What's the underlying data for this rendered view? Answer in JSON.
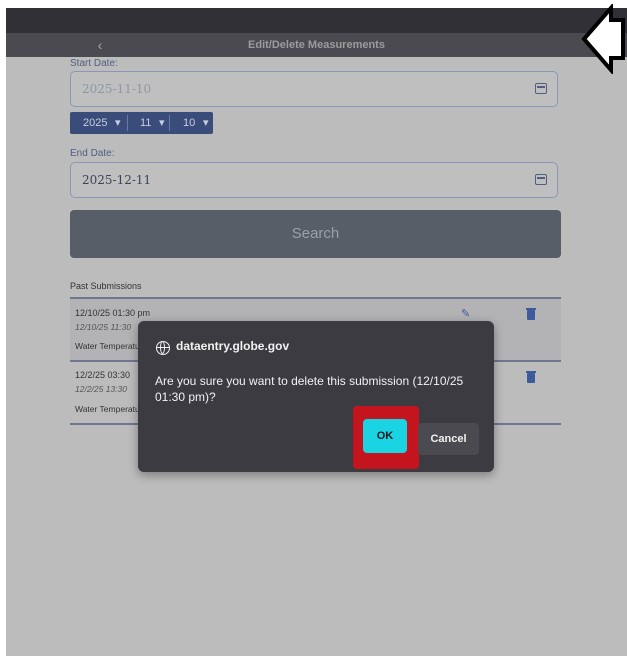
{
  "header": {
    "back_icon": "chevron-left-icon",
    "title": "Edit/Delete Measurements"
  },
  "start_date": {
    "label": "Start Date:",
    "value": "2025-11-10",
    "picker": {
      "year": "2025",
      "month": "11",
      "day": "10"
    }
  },
  "end_date": {
    "label": "End Date:",
    "value": "2025-12-11"
  },
  "search": {
    "label": "Search"
  },
  "past": {
    "title": "Past Submissions",
    "rows": [
      {
        "time": "12/10/25 01:30 pm",
        "sub": "12/10/25 11:30",
        "type": "Water Temperature"
      },
      {
        "time": "12/2/25 03:30",
        "sub": "12/2/25 13:30",
        "type": "Water Temperature"
      }
    ]
  },
  "dialog": {
    "site_icon": "globe-icon",
    "site": "dataentry.globe.gov",
    "message": "Are you sure you want to delete this submission (12/10/25 01:30 pm)?",
    "ok_label": "OK",
    "cancel_label": "Cancel"
  },
  "colors": {
    "dialog_bg": "#3c3b41",
    "ok_button": "#1ad3e3",
    "highlight": "#c4141e",
    "accent": "#3d5b9a"
  }
}
